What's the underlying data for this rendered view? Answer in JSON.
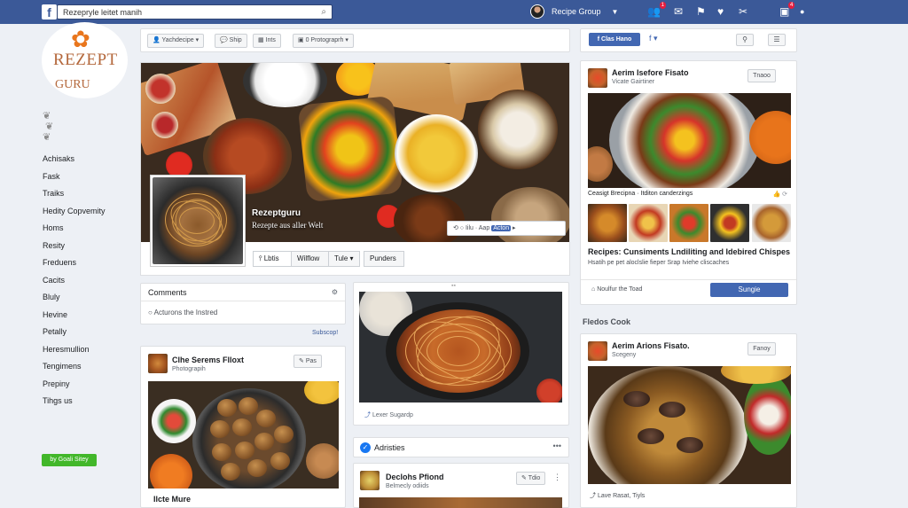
{
  "topbar": {
    "logo": "f",
    "search_value": "Rezepryle leitet manih",
    "profile_name": "Recipe Group",
    "badge1": "1",
    "badge2": "4"
  },
  "logo": {
    "line1": "REZEPT",
    "line2": "GURU"
  },
  "sidebar": {
    "items": [
      {
        "label": "Achisaks"
      },
      {
        "label": "Fask"
      },
      {
        "label": "Traiks"
      },
      {
        "label": "Hedity Copvemity"
      },
      {
        "label": "Homs"
      },
      {
        "label": "Resity"
      },
      {
        "label": "Freduens"
      },
      {
        "label": "Cacits"
      },
      {
        "label": "Bluly"
      },
      {
        "label": "Hevine"
      },
      {
        "label": "Petally"
      },
      {
        "label": "Heresmullion"
      },
      {
        "label": "Tengimens"
      },
      {
        "label": "Prepiny"
      },
      {
        "label": "Tihgs us"
      }
    ],
    "footer_button": "by Goali Sitey"
  },
  "toolbar": {
    "btn1": "Yachdecipe",
    "btn2": "Ship",
    "btn3": "Ints",
    "btn4": "0 Protograprh"
  },
  "right_toolbar": {
    "like": "f Clas Hano",
    "fb": "f"
  },
  "cover": {
    "page_name": "Rezeptguru",
    "page_sub": "Rezepte aus aller Welt",
    "action_text": "Iilu · Aap",
    "action_blue": "Acton",
    "tabs": [
      "Lbtis",
      "Wilflow",
      "Tule",
      "Punders"
    ]
  },
  "comments": {
    "title": "Comments",
    "option": "Acturons the Instred",
    "subscribe": "Subscop!"
  },
  "post_left": {
    "title": "Clhe Serems Flloxt",
    "sub": "Photograpih",
    "button": "Pas",
    "caption": "Ilcte Mure"
  },
  "post_middle": {
    "caption": "Lexer Sugardp"
  },
  "adr": {
    "label": "Adristies",
    "dots": "•••"
  },
  "post_bottom": {
    "title": "Declohs Pfiond",
    "sub": "Belmecly odiids",
    "button": "Tdio"
  },
  "right_post1": {
    "title": "Aerim Isefore Fisato",
    "sub": "Vicate Gairtiner",
    "button": "Tnaoo",
    "caption": "Ceasigt Brecipna · Itditon canderzings",
    "heading": "Recipes: Cunsiments Lndiliting and Idebired Chispes",
    "para": "Hsatih pe pet aloclslie fieper Srap Iviehe cliscaches",
    "footer_left": "Noulfur the Toad",
    "footer_btn": "Sungie"
  },
  "right_section": "Fledos Cook",
  "right_post2": {
    "title": "Aerim Arions Fisato.",
    "sub": "Scegeny",
    "button": "Fanoy",
    "footer": "Lave Rasat, Tiyls"
  }
}
